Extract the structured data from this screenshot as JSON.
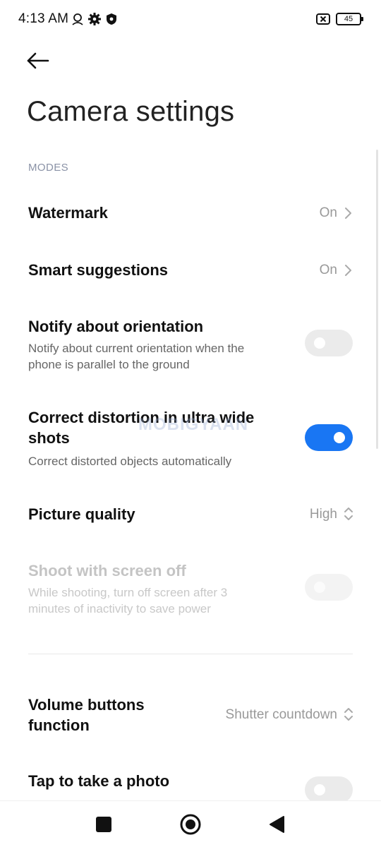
{
  "status_bar": {
    "time": "4:13 AM",
    "battery": "45",
    "icons": [
      "location-icon",
      "gear-icon",
      "shield-icon",
      "battery-x-icon",
      "battery-icon"
    ]
  },
  "header": {
    "title": "Camera settings"
  },
  "section": {
    "label": "MODES"
  },
  "rows": {
    "watermark": {
      "title": "Watermark",
      "value": "On"
    },
    "smart_suggestions": {
      "title": "Smart suggestions",
      "value": "On"
    },
    "notify_orientation": {
      "title": "Notify about orientation",
      "desc_line1": "Notify about current orientation when the",
      "desc_line2": "phone is parallel to the ground",
      "enabled": false
    },
    "correct_distortion": {
      "title_line1": "Correct distortion in ultra wide",
      "title_line2": "shots",
      "desc": "Correct distorted objects automatically",
      "enabled": true
    },
    "picture_quality": {
      "title": "Picture quality",
      "value": "High"
    },
    "shoot_screen_off": {
      "title": "Shoot with screen off",
      "desc_line1": "While shooting, turn off screen after 3",
      "desc_line2": "minutes of inactivity to save power",
      "enabled": false,
      "disabled": true
    },
    "volume_buttons": {
      "title_line1": "Volume buttons",
      "title_line2": "function",
      "value": "Shutter countdown"
    },
    "tap_photo": {
      "title": "Tap to take a photo",
      "enabled": false
    }
  },
  "watermark_overlay": "MOBIGYAAN",
  "colors": {
    "accent": "#1976f3",
    "toggle_off": "#ebebeb",
    "secondary_text": "#999999",
    "section_header": "#8a92a6"
  }
}
